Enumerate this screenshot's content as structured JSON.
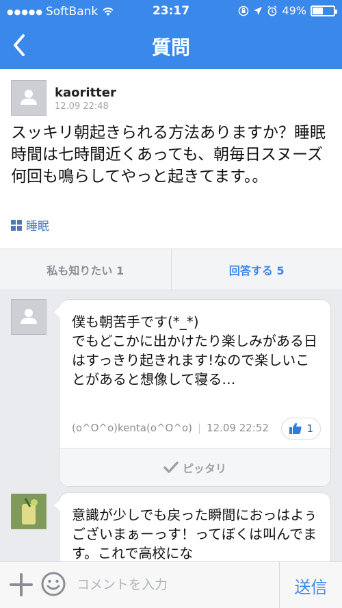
{
  "status_bar": {
    "carrier": "SoftBank",
    "time": "23:17",
    "battery_percent": "49%",
    "battery_level": 0.49
  },
  "nav": {
    "title": "質問",
    "back_icon": "chevron-left-icon"
  },
  "question": {
    "username": "kaoritter",
    "timestamp": "12.09 22:48",
    "body": "スッキリ朝起きられる方法ありますか？睡眠時間は七時間近くあっても、朝毎日スヌーズ何回も鳴らしてやっと起きてます。。",
    "tag": "睡眠"
  },
  "actions": {
    "me_too": "私も知りたい 1",
    "answer": "回答する 5"
  },
  "answers": [
    {
      "body": "僕も朝苦手です(*_*)\nでもどこかに出かけたり楽しみがある日はすっきり起きれます!なので楽しいことがあると想像して寝る…",
      "author": "(o^O^o)kenta(o^O^o)",
      "timestamp": "12.09 22:52",
      "likes": "1",
      "footer": "ピッタリ"
    },
    {
      "body": "意識が少しでも戻った瞬間におっはよぅございまぁーっす！ってぼくは叫んでます。これで高校にな"
    }
  ],
  "composer": {
    "placeholder": "コメントを入力",
    "send_label": "送信"
  },
  "colors": {
    "accent": "#3a88ea",
    "tag": "#4a79b6"
  }
}
